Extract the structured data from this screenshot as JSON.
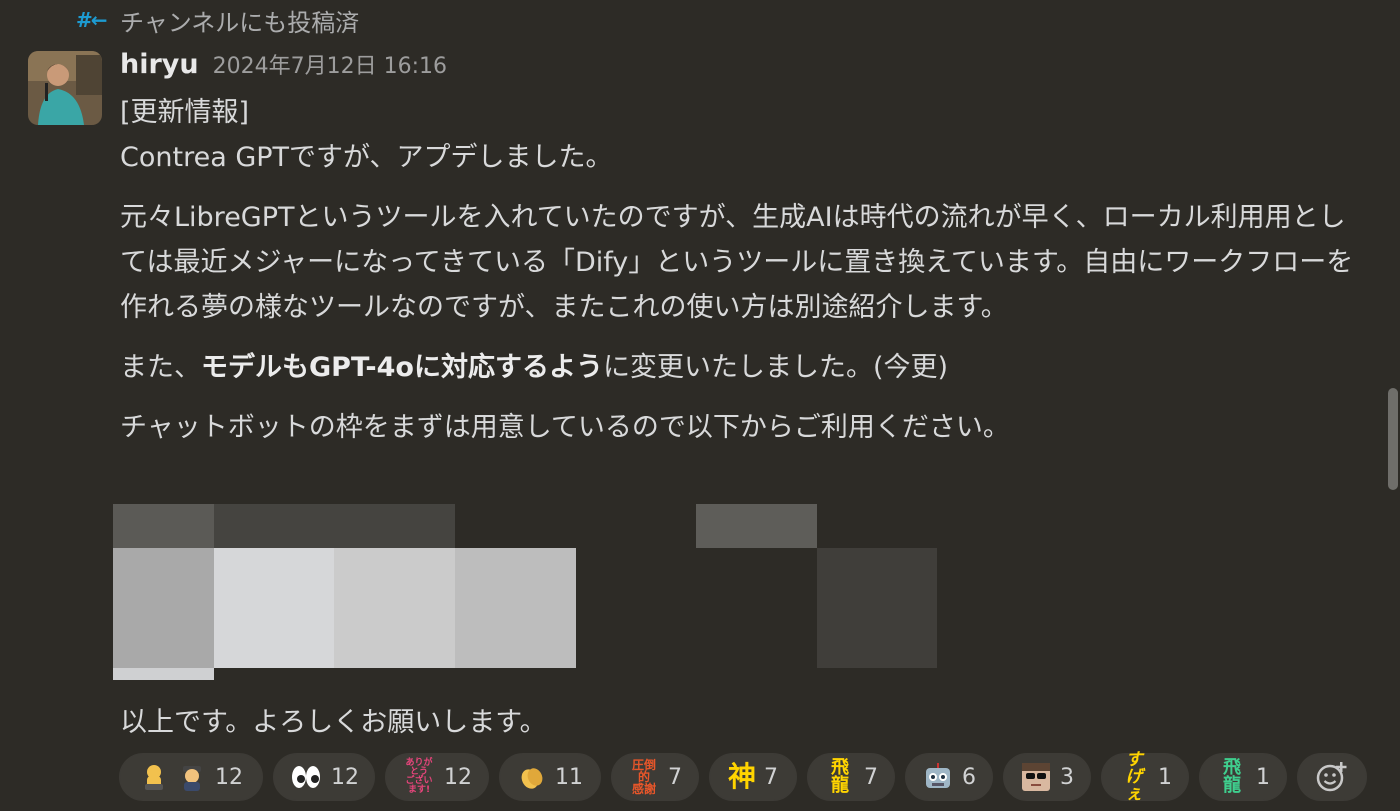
{
  "thread_note": {
    "icon": "hash-arrow-icon",
    "text": "チャンネルにも投稿済"
  },
  "message": {
    "author": "hiryu",
    "timestamp": "2024年7月12日 16:16",
    "lines": {
      "l1": "[更新情報]",
      "l2": "Contrea GPTですが、アプデしました。",
      "p2": "元々LibreGPTというツールを入れていたのですが、生成AIは時代の流れが早く、ローカル利用用としては最近メジャーになってきている「Dify」というツールに置き換えています。自由にワークフローを作れる夢の様なツールなのですが、またこれの使い方は別途紹介します。",
      "p3_pre": "また、",
      "p3_bold": "モデルもGPT-4oに対応するよう",
      "p3_post": "に変更いたしました。(今更)",
      "p4": "チャットボットの枠をまずは用意しているので以下からご利用ください。"
    },
    "closing": "以上です。よろしくお願いします。"
  },
  "reactions": [
    {
      "icons": [
        "bowing-person-icon",
        "detective-icon"
      ],
      "count": "12"
    },
    {
      "icons": [
        "eyes-icon"
      ],
      "count": "12"
    },
    {
      "icons": [
        "arigatou-text-emoji-icon"
      ],
      "count": "12"
    },
    {
      "icons": [
        "clapping-hands-icon"
      ],
      "count": "11"
    },
    {
      "icons": [
        "appreciation-text-emoji-icon"
      ],
      "count": "7"
    },
    {
      "icons": [
        "kami-text-emoji-icon"
      ],
      "count": "7"
    },
    {
      "icons": [
        "hiryu-kanji-emoji-icon"
      ],
      "count": "7"
    },
    {
      "icons": [
        "robot-face-icon"
      ],
      "count": "6"
    },
    {
      "icons": [
        "sunglasses-face-icon"
      ],
      "count": "3"
    },
    {
      "icons": [
        "sugee-text-emoji-icon"
      ],
      "count": "1"
    },
    {
      "icons": [
        "hiryu-green-emoji-icon"
      ],
      "count": "1"
    }
  ],
  "add_reaction_icon": "add-emoji-icon",
  "colors": {
    "background": "#2d2b26",
    "link_blue": "#1d9bd1",
    "pill_bg": "#3d3b36"
  }
}
